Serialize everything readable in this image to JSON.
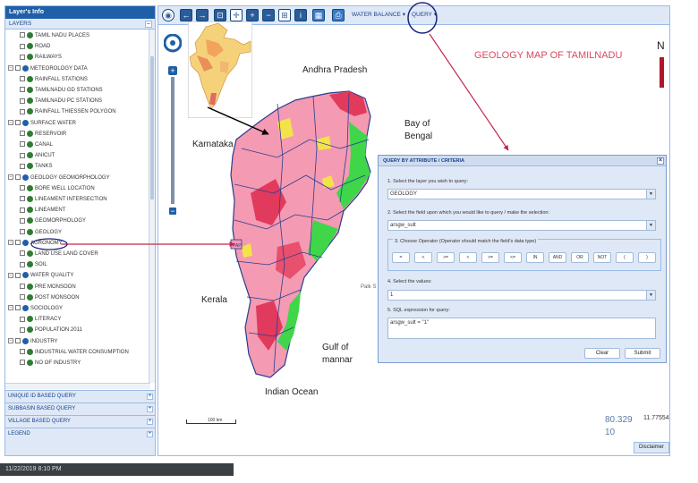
{
  "layers_panel": {
    "title": "Layer's Info",
    "section": "LAYERS",
    "tree": [
      {
        "label": "TAMIL NADU PLACES",
        "level": 2,
        "kind": "leaf"
      },
      {
        "label": "ROAD",
        "level": 2,
        "kind": "leaf"
      },
      {
        "label": "RAILWAYS",
        "level": 2,
        "kind": "leaf"
      },
      {
        "label": "METEOROLOGY DATA",
        "level": 1,
        "kind": "group"
      },
      {
        "label": "RAINFALL STATIONS",
        "level": 2,
        "kind": "leaf"
      },
      {
        "label": "TAMILNADU GD STATIONS",
        "level": 2,
        "kind": "leaf"
      },
      {
        "label": "TAMILNADU PC STATIONS",
        "level": 2,
        "kind": "leaf"
      },
      {
        "label": "RAINFALL THIESSEN POLYGON",
        "level": 2,
        "kind": "leaf"
      },
      {
        "label": "SURFACE WATER",
        "level": 1,
        "kind": "group"
      },
      {
        "label": "RESERVOIR",
        "level": 2,
        "kind": "leaf"
      },
      {
        "label": "CANAL",
        "level": 2,
        "kind": "leaf"
      },
      {
        "label": "ANICUT",
        "level": 2,
        "kind": "leaf"
      },
      {
        "label": "TANKS",
        "level": 2,
        "kind": "leaf"
      },
      {
        "label": "GEOLOGY GEOMORPHOLOGY",
        "level": 1,
        "kind": "group"
      },
      {
        "label": "BORE WELL LOCATION",
        "level": 2,
        "kind": "leaf"
      },
      {
        "label": "LINEAMENT INTERSECTION",
        "level": 2,
        "kind": "leaf"
      },
      {
        "label": "LINEAMENT",
        "level": 2,
        "kind": "leaf"
      },
      {
        "label": "GEOMORPHOLOGY",
        "level": 2,
        "kind": "leaf"
      },
      {
        "label": "GEOLOGY",
        "level": 2,
        "kind": "leaf"
      },
      {
        "label": "AGRONOMY",
        "level": 1,
        "kind": "group"
      },
      {
        "label": "LAND USE LAND COVER",
        "level": 2,
        "kind": "leaf"
      },
      {
        "label": "SOIL",
        "level": 2,
        "kind": "leaf"
      },
      {
        "label": "WATER QUALITY",
        "level": 1,
        "kind": "group"
      },
      {
        "label": "PRE MONSOON",
        "level": 2,
        "kind": "leaf"
      },
      {
        "label": "POST MONSOON",
        "level": 2,
        "kind": "leaf"
      },
      {
        "label": "SOCIOLOGY",
        "level": 1,
        "kind": "group"
      },
      {
        "label": "LITERACY",
        "level": 2,
        "kind": "leaf"
      },
      {
        "label": "POPULATION 2011",
        "level": 2,
        "kind": "leaf"
      },
      {
        "label": "INDUSTRY",
        "level": 1,
        "kind": "group"
      },
      {
        "label": "INDUSTRIAL WATER CONSUMPTION",
        "level": 2,
        "kind": "leaf"
      },
      {
        "label": "NO OF INDUSTRY",
        "level": 2,
        "kind": "leaf"
      }
    ],
    "accordions": [
      "UNIQUE ID BASED QUERY",
      "SUBBASIN BASED QUERY",
      "VILLAGE BASED QUERY",
      "LEGEND"
    ]
  },
  "toolbar": {
    "water_balance": "WATER BALANCE",
    "query": "QUERY"
  },
  "map": {
    "title": "GEOLOGY MAP OF TAMILNADU",
    "north": "N",
    "labels": {
      "andhra": "Andhra Pradesh",
      "karnataka": "Karnataka",
      "kerala": "Kerala",
      "bay": "Bay of",
      "bay2": "Bengal",
      "gulf": "Gulf of",
      "gulf2": "mannar",
      "ocean": "Indian Ocean",
      "palk": "Palk S"
    },
    "coord_a": "80.329",
    "coord_b": "10",
    "coord_c": "11.77554",
    "disclaimer": "Disclaimer",
    "scale_text": "100 km"
  },
  "query_panel": {
    "title": "QUERY BY ATTRIBUTE / CRITERIA",
    "step1": "1. Select the layer you wish to query:",
    "layer_value": "GEOLOGY",
    "step2": "2. Select the field upon which you would like to query / make the selection:",
    "field_value": "arsgw_sult",
    "step3": "3. Choose Operator (Operator should match the field's data type)",
    "operators": [
      "=",
      "<",
      ">=",
      "<",
      ">=",
      "<=",
      "IN",
      "AND",
      "OR",
      "NOT",
      "(",
      ")"
    ],
    "step4": "4. Select the values:",
    "value": "1",
    "step5": "5. SQL expression for query:",
    "sql": "arsgw_sult = \"1\"",
    "clear": "Clear",
    "submit": "Submit"
  },
  "status": {
    "text": "11/22/2019 8:10 PM"
  }
}
